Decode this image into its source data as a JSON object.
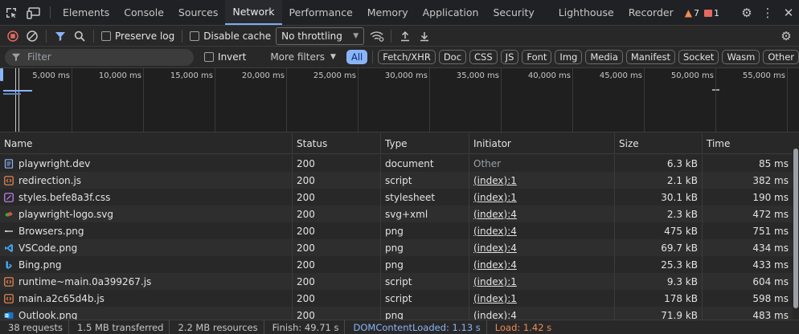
{
  "tabs": [
    {
      "label": "Elements",
      "active": false
    },
    {
      "label": "Console",
      "active": false
    },
    {
      "label": "Sources",
      "active": false
    },
    {
      "label": "Network",
      "active": true
    },
    {
      "label": "Performance",
      "active": false
    },
    {
      "label": "Memory",
      "active": false
    },
    {
      "label": "Application",
      "active": false
    },
    {
      "label": "Security",
      "active": false
    },
    {
      "label": "Lighthouse",
      "active": false
    },
    {
      "label": "Recorder",
      "active": false
    }
  ],
  "issues": {
    "warnings": "7",
    "errors": "1"
  },
  "toolbar": {
    "preserve_log": "Preserve log",
    "disable_cache": "Disable cache",
    "throttling": "No throttling"
  },
  "filter": {
    "placeholder": "Filter",
    "invert": "Invert",
    "more_filters": "More filters",
    "types": [
      "All",
      "Fetch/XHR",
      "Doc",
      "CSS",
      "JS",
      "Font",
      "Img",
      "Media",
      "Manifest",
      "Socket",
      "Wasm",
      "Other"
    ],
    "active_type": "All"
  },
  "overview": {
    "ticks": [
      "5,000 ms",
      "10,000 ms",
      "15,000 ms",
      "20,000 ms",
      "25,000 ms",
      "30,000 ms",
      "35,000 ms",
      "40,000 ms",
      "45,000 ms",
      "50,000 ms",
      "55,000 ms"
    ]
  },
  "table": {
    "columns": [
      "Name",
      "Status",
      "Type",
      "Initiator",
      "Size",
      "Time"
    ],
    "rows": [
      {
        "name": "playwright.dev",
        "icon": "document-icon",
        "status": "200",
        "type": "document",
        "initiator": "Other",
        "initiator_link": false,
        "size": "6.3 kB",
        "time": "85 ms"
      },
      {
        "name": "redirection.js",
        "icon": "script-icon",
        "status": "200",
        "type": "script",
        "initiator": "(index):1",
        "initiator_link": true,
        "size": "2.1 kB",
        "time": "382 ms"
      },
      {
        "name": "styles.befe8a3f.css",
        "icon": "stylesheet-icon",
        "status": "200",
        "type": "stylesheet",
        "initiator": "(index):1",
        "initiator_link": true,
        "size": "30.1 kB",
        "time": "190 ms"
      },
      {
        "name": "playwright-logo.svg",
        "icon": "playwright-logo-icon",
        "status": "200",
        "type": "svg+xml",
        "initiator": "(index):4",
        "initiator_link": true,
        "size": "2.3 kB",
        "time": "472 ms"
      },
      {
        "name": "Browsers.png",
        "icon": "image-thumbnail-icon",
        "status": "200",
        "type": "png",
        "initiator": "(index):4",
        "initiator_link": true,
        "size": "475 kB",
        "time": "751 ms"
      },
      {
        "name": "VSCode.png",
        "icon": "vscode-icon",
        "status": "200",
        "type": "png",
        "initiator": "(index):4",
        "initiator_link": true,
        "size": "69.7 kB",
        "time": "434 ms"
      },
      {
        "name": "Bing.png",
        "icon": "bing-icon",
        "status": "200",
        "type": "png",
        "initiator": "(index):4",
        "initiator_link": true,
        "size": "25.3 kB",
        "time": "433 ms"
      },
      {
        "name": "runtime~main.0a399267.js",
        "icon": "script-icon",
        "status": "200",
        "type": "script",
        "initiator": "(index):1",
        "initiator_link": true,
        "size": "9.3 kB",
        "time": "604 ms"
      },
      {
        "name": "main.a2c65d4b.js",
        "icon": "script-icon",
        "status": "200",
        "type": "script",
        "initiator": "(index):1",
        "initiator_link": true,
        "size": "178 kB",
        "time": "598 ms"
      },
      {
        "name": "Outlook.png",
        "icon": "outlook-icon",
        "status": "200",
        "type": "png",
        "initiator": "(index):4",
        "initiator_link": true,
        "size": "71.9 kB",
        "time": "483 ms"
      }
    ]
  },
  "status": {
    "requests": "38 requests",
    "transferred": "1.5 MB transferred",
    "resources": "2.2 MB resources",
    "finish": "Finish: 49.71 s",
    "dom_content_loaded": "DOMContentLoaded: 1.13 s",
    "load": "Load: 1.42 s"
  },
  "colors": {
    "accent": "#8ab4f8",
    "record": "#e46962",
    "dom_content_loaded": "#8ab4f8",
    "load": "#f28b54"
  }
}
